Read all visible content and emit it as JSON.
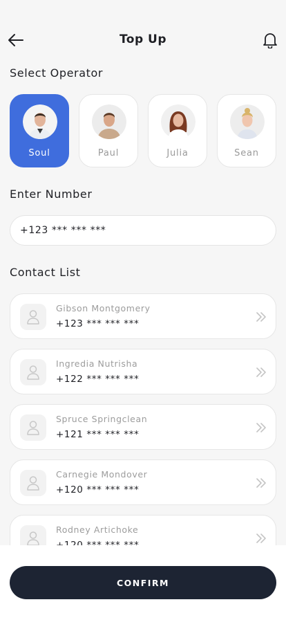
{
  "header": {
    "title": "Top Up",
    "back_icon": "arrow-left-icon",
    "bell_icon": "bell-icon"
  },
  "operator_section": {
    "title": "Select Operator",
    "selected": "Soul",
    "operators": [
      {
        "name": "Soul",
        "selected": true
      },
      {
        "name": "Paul",
        "selected": false
      },
      {
        "name": "Julia",
        "selected": false
      },
      {
        "name": "Sean",
        "selected": false
      }
    ]
  },
  "number_section": {
    "title": "Enter Number",
    "value": "+123 *** *** ***"
  },
  "contacts_section": {
    "title": "Contact List",
    "contacts": [
      {
        "name": "Gibson Montgomery",
        "number": "+123 *** *** ***"
      },
      {
        "name": "Ingredia Nutrisha",
        "number": "+122 *** *** ***"
      },
      {
        "name": "Spruce Springclean",
        "number": "+121 *** *** ***"
      },
      {
        "name": "Carnegie Mondover",
        "number": "+120 *** *** ***"
      },
      {
        "name": "Rodney Artichoke",
        "number": "+120 *** *** ***"
      }
    ]
  },
  "confirm_label": "CONFIRM",
  "colors": {
    "accent": "#3f6ddd",
    "button_dark": "#1d2433",
    "background": "#f6f6f6"
  }
}
